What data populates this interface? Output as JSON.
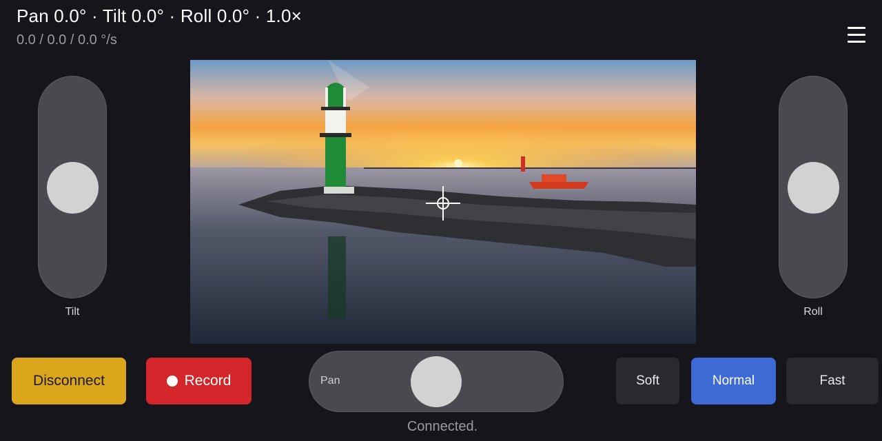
{
  "header": {
    "title": "Pan 0.0° · Tilt 0.0° · Roll 0.0° · 1.0×",
    "rates": "0.0 / 0.0 / 0.0 °/s"
  },
  "icons": {
    "menu": "hamburger-menu-icon",
    "record_dot": "record-dot-icon",
    "crosshair": "crosshair-icon"
  },
  "sliders": {
    "tilt": {
      "label": "Tilt",
      "value": 0.0
    },
    "roll": {
      "label": "Roll",
      "value": 0.0
    },
    "pan": {
      "label": "Pan",
      "value": 0.0
    }
  },
  "buttons": {
    "disconnect": "Disconnect",
    "record": "Record"
  },
  "speed_modes": {
    "options": [
      "Soft",
      "Normal",
      "Fast"
    ],
    "selected": "Normal"
  },
  "status": "Connected.",
  "colors": {
    "background": "#16151c",
    "disconnect": "#d9a61c",
    "record": "#d3262a",
    "selected_mode": "#3e6ad6",
    "mode_button": "#2a292f",
    "slider_track": "#4a494f",
    "slider_thumb": "#d2d2d3"
  }
}
